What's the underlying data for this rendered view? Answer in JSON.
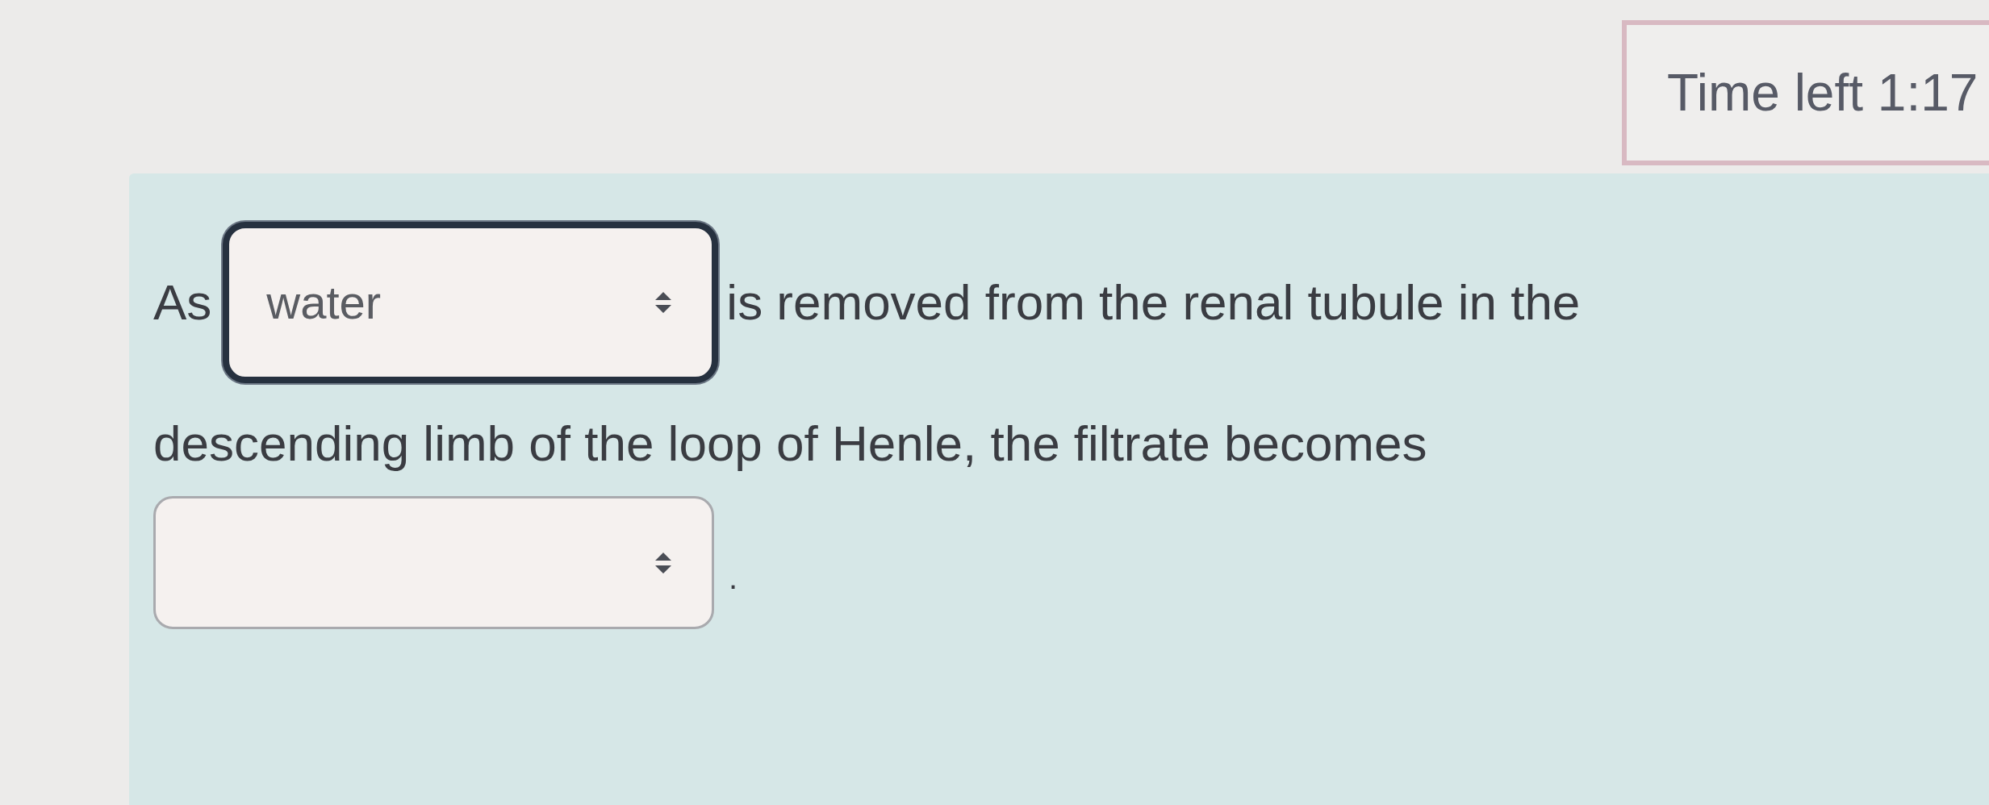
{
  "timer": {
    "label": "Time left 1:17"
  },
  "question": {
    "lines": [
      [
        {
          "kind": "text",
          "text": "As"
        },
        {
          "kind": "select",
          "value": "water",
          "focused": true
        },
        {
          "kind": "text",
          "text": "is removed from the renal tubule in the"
        }
      ],
      [
        {
          "kind": "text",
          "text": "descending limb of the loop of Henle, the filtrate becomes"
        }
      ],
      [
        {
          "kind": "select",
          "focused": false
        },
        {
          "kind": "text",
          "text": "."
        }
      ]
    ]
  }
}
